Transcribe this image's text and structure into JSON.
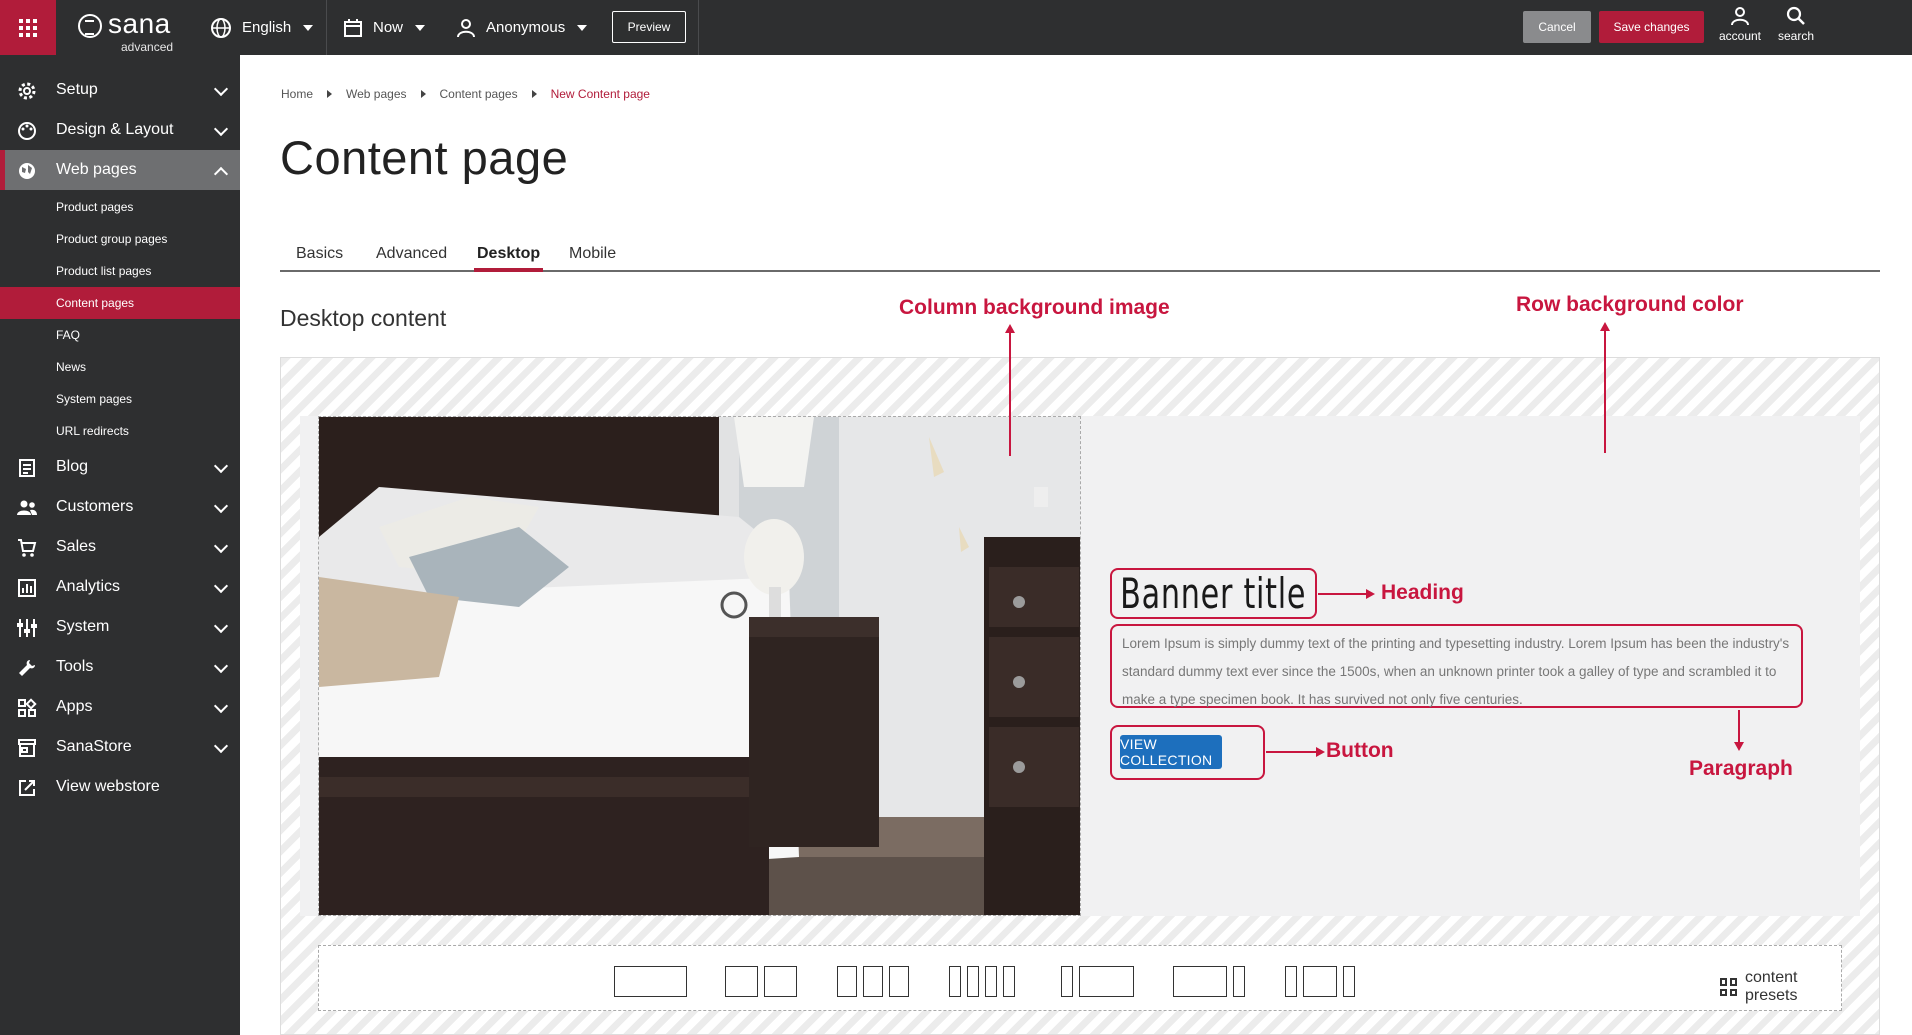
{
  "topbar": {
    "logo_text": "sana",
    "logo_sub": "advanced",
    "language": "English",
    "time": "Now",
    "user": "Anonymous",
    "preview_label": "Preview",
    "cancel_label": "Cancel",
    "save_label": "Save changes",
    "account_label": "account",
    "search_label": "search"
  },
  "sidebar": {
    "items": [
      {
        "label": "Setup",
        "icon": "gear-icon"
      },
      {
        "label": "Design & Layout",
        "icon": "palette-icon"
      },
      {
        "label": "Web pages",
        "icon": "globe-icon"
      },
      {
        "label": "Blog",
        "icon": "blog-icon"
      },
      {
        "label": "Customers",
        "icon": "users-icon"
      },
      {
        "label": "Sales",
        "icon": "cart-icon"
      },
      {
        "label": "Analytics",
        "icon": "chart-icon"
      },
      {
        "label": "System",
        "icon": "sliders-icon"
      },
      {
        "label": "Tools",
        "icon": "wrench-icon"
      },
      {
        "label": "Apps",
        "icon": "apps-icon"
      },
      {
        "label": "SanaStore",
        "icon": "store-icon"
      },
      {
        "label": "View webstore",
        "icon": "external-link-icon"
      }
    ],
    "subitems": [
      {
        "label": "Product pages"
      },
      {
        "label": "Product group pages"
      },
      {
        "label": "Product list pages"
      },
      {
        "label": "Content pages"
      },
      {
        "label": "FAQ"
      },
      {
        "label": "News"
      },
      {
        "label": "System pages"
      },
      {
        "label": "URL redirects"
      }
    ]
  },
  "breadcrumb": [
    "Home",
    "Web pages",
    "Content pages",
    "New Content page"
  ],
  "page_title": "Content page",
  "tabs": [
    "Basics",
    "Advanced",
    "Desktop",
    "Mobile"
  ],
  "active_tab": "Desktop",
  "section_title": "Desktop content",
  "banner": {
    "title": "Banner title",
    "paragraph": "Lorem Ipsum is simply dummy text of the printing and typesetting industry. Lorem Ipsum has been the industry's standard dummy text ever since the 1500s, when an unknown printer took a galley of type and scrambled it to make a type specimen book. It has survived not only five centuries.",
    "button_label": "VIEW COLLECTION"
  },
  "annotations": {
    "column_bg": "Column background image",
    "row_bg": "Row background color",
    "heading": "Heading",
    "button": "Button",
    "paragraph": "Paragraph"
  },
  "presets_label": "content presets",
  "colors": {
    "brand": "#b11c3a",
    "topbar": "#2e2f30",
    "annotation": "#c8163f",
    "button": "#1d6fbd"
  }
}
